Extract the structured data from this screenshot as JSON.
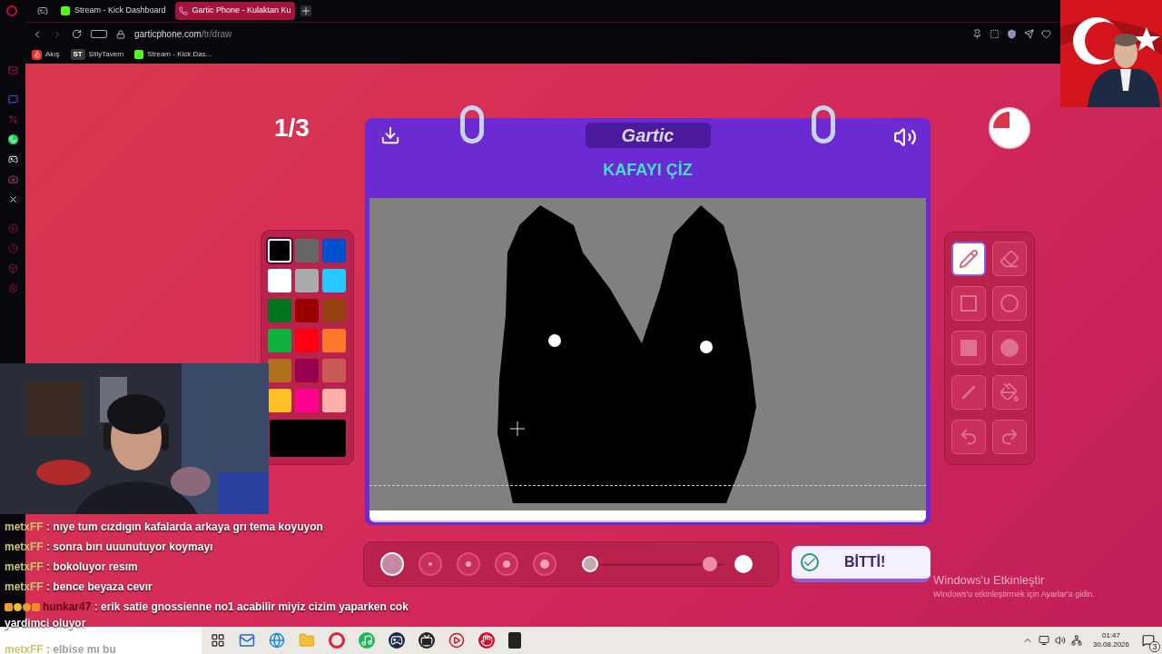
{
  "browser": {
    "tabs": [
      {
        "title": "Stream - Kick Dashboard",
        "selected": false,
        "kind": "kick"
      },
      {
        "title": "Gartic Phone - Kulaktan Ku",
        "selected": true,
        "kind": "phone"
      }
    ],
    "url_host": "garticphone.com",
    "url_path": "/tr/draw",
    "bookmarks": [
      {
        "label": "Akış",
        "kind": "flame"
      },
      {
        "label": "SillyTavern",
        "kind": "letters",
        "icon_text": "ST"
      },
      {
        "label": "Stream - Kick Das...",
        "kind": "kick"
      }
    ]
  },
  "game": {
    "round": "1/3",
    "logo": "Gartic",
    "title": "KAFAYI ÇİZ",
    "palette": [
      {
        "color": "#000000",
        "selected": true
      },
      {
        "color": "#666666",
        "selected": false
      },
      {
        "color": "#0050cd",
        "selected": false
      },
      {
        "color": "#ffffff",
        "selected": false
      },
      {
        "color": "#aaaaaa",
        "selected": false
      },
      {
        "color": "#26c9ff",
        "selected": false
      },
      {
        "color": "#017420",
        "selected": false
      },
      {
        "color": "#990000",
        "selected": false
      },
      {
        "color": "#964112",
        "selected": false
      },
      {
        "color": "#11b03c",
        "selected": false
      },
      {
        "color": "#ff0013",
        "selected": false
      },
      {
        "color": "#ff7829",
        "selected": false
      },
      {
        "color": "#b0701c",
        "selected": false
      },
      {
        "color": "#99004e",
        "selected": false
      },
      {
        "color": "#cb5a57",
        "selected": false
      },
      {
        "color": "#ffc126",
        "selected": false
      },
      {
        "color": "#ff008f",
        "selected": false
      },
      {
        "color": "#feafa8",
        "selected": false
      }
    ],
    "tools": [
      {
        "kind": "pencil",
        "selected": true
      },
      {
        "kind": "eraser",
        "selected": false
      },
      {
        "kind": "rect",
        "selected": false
      },
      {
        "kind": "ellipse",
        "selected": false
      },
      {
        "kind": "rect_fill",
        "selected": false
      },
      {
        "kind": "ellipse_fill",
        "selected": false
      },
      {
        "kind": "line",
        "selected": false
      },
      {
        "kind": "bucket",
        "selected": false
      },
      {
        "kind": "undo",
        "selected": false
      },
      {
        "kind": "redo",
        "selected": false
      }
    ],
    "brush_sizes": [
      {
        "selected": true
      },
      {
        "selected": false
      },
      {
        "selected": false
      },
      {
        "selected": false
      },
      {
        "selected": false
      }
    ],
    "opacity_slider": {
      "level": 0.93
    },
    "done_button": "BİTTİ!"
  },
  "chat": [
    {
      "user": "metxFF",
      "text": ": nıye tum cızdıgın kafalarda arkaya grı tema koyuyon",
      "color": "#c8c870",
      "kind": "plain"
    },
    {
      "user": "metxFF",
      "text": ": sonra bırı uuunutuyor koymayı",
      "color": "#c8c870",
      "kind": "plain"
    },
    {
      "user": "metxFF",
      "text": ": bokoluyor resım",
      "color": "#c8c870",
      "kind": "plain"
    },
    {
      "user": "metxFF",
      "text": ": bence beyaza cevır",
      "color": "#c8c870",
      "kind": "plain"
    },
    {
      "user": "hunkar47",
      "text": ": erik satie gnossienne no1 acabilir miyiz cizim yaparken cok yardimci oluyor",
      "color": "#5a0010",
      "kind": "badged"
    },
    {
      "user": "metxFF",
      "text": ": elbise mı bu",
      "color": "#c8c870",
      "kind": "faded"
    }
  ],
  "activation": {
    "title": "Windows'u Etkinleştir",
    "subtitle": "Windows'u etkinleştirmek için Ayarlar'a gidin."
  },
  "taskbar": {
    "time": "01:47",
    "date": "30.08.2026",
    "notifications": "3"
  }
}
